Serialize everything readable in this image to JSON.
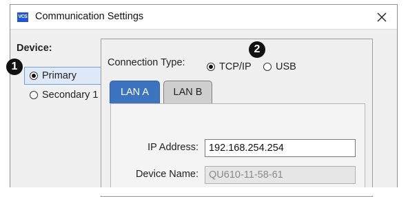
{
  "window": {
    "title": "Communication Settings",
    "icon_text": "VCS",
    "close_symbol": "X"
  },
  "device": {
    "label": "Device:",
    "options": [
      {
        "label": "Primary",
        "selected": true
      },
      {
        "label": "Secondary 1",
        "selected": false
      }
    ]
  },
  "connection": {
    "label": "Connection Type:",
    "options": [
      {
        "label": "TCP/IP",
        "selected": true
      },
      {
        "label": "USB",
        "selected": false
      }
    ]
  },
  "tabs": [
    {
      "label": "LAN A",
      "active": true
    },
    {
      "label": "LAN B",
      "active": false
    }
  ],
  "fields": {
    "ip_address": {
      "label": "IP Address:",
      "value": "192.168.254.254"
    },
    "device_name": {
      "label": "Device Name:",
      "value": "QU610-11-58-61"
    }
  },
  "callouts": [
    "1",
    "2"
  ],
  "colors": {
    "active_tab": "#3c74c0",
    "selected_highlight": "#dde9f6",
    "callout": "#111111"
  }
}
